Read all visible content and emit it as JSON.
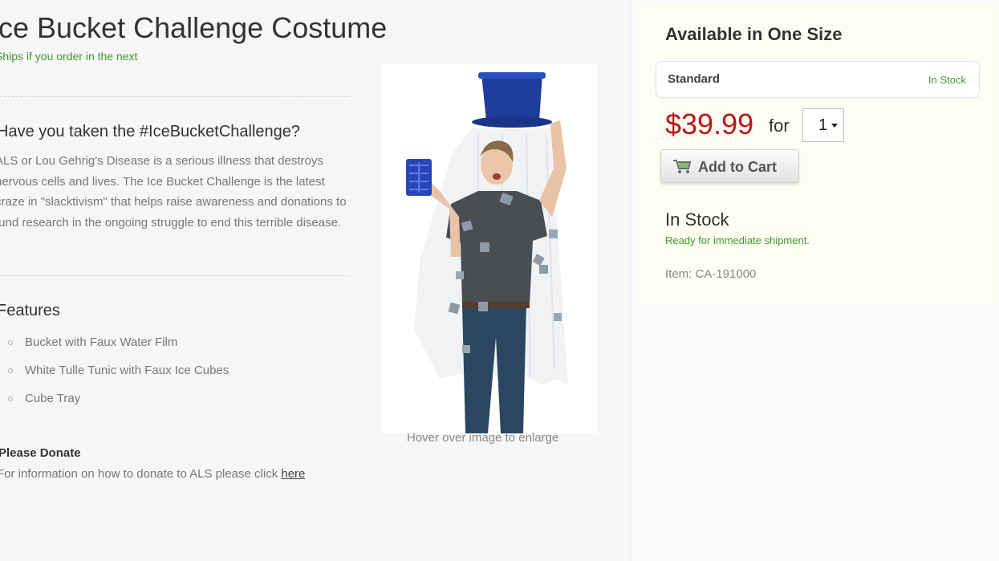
{
  "product": {
    "title": "Ice Bucket Challenge Costume",
    "ships_note": "Ships if you order in the next"
  },
  "description": {
    "heading": "Have you taken the #IceBucketChallenge?",
    "body": "ALS or Lou Gehrig's Disease is a serious illness that destroys nervous cells and lives. The Ice Bucket Challenge is the latest craze in \"slacktivism\" that helps raise awareness and donations to fund research in the ongoing struggle to end this terrible disease."
  },
  "features": {
    "heading": "Features",
    "items": [
      "Bucket with Faux Water Film",
      "White Tulle Tunic with Faux Ice Cubes",
      "Cube Tray"
    ]
  },
  "donate": {
    "heading": "Please Donate",
    "text": "For information on how to donate to ALS please click",
    "link": "here"
  },
  "image": {
    "caption": "Hover over image to enlarge"
  },
  "purchase": {
    "size_heading": "Available in One Size",
    "size_name": "Standard",
    "size_stock": "In Stock",
    "price": "$39.99",
    "for_label": "for",
    "quantity": "1",
    "add_to_cart": "Add to Cart",
    "stock_heading": "In Stock",
    "stock_note": "Ready for immediate shipment.",
    "item_number": "Item: CA-191000"
  },
  "colors": {
    "price": "#b8181c",
    "in_stock": "#3d9a2d",
    "buy_box": "#fdfdf1"
  },
  "icons": [
    "cart-icon",
    "chevron-down-icon"
  ]
}
